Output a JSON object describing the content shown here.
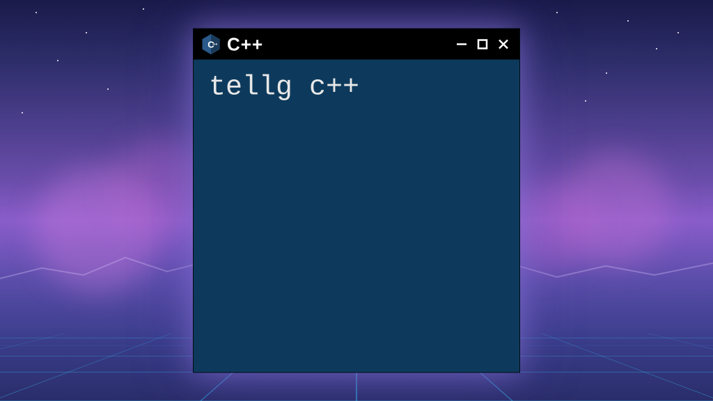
{
  "titlebar": {
    "title": "C++",
    "icon_label": "cpp-icon"
  },
  "window_controls": {
    "minimize": "—",
    "maximize": "☐",
    "close": "✕"
  },
  "content": {
    "text": "tellg c++"
  },
  "colors": {
    "window_bg": "#0d3a5c",
    "titlebar_bg": "#000000",
    "text": "#e8e8e8"
  }
}
